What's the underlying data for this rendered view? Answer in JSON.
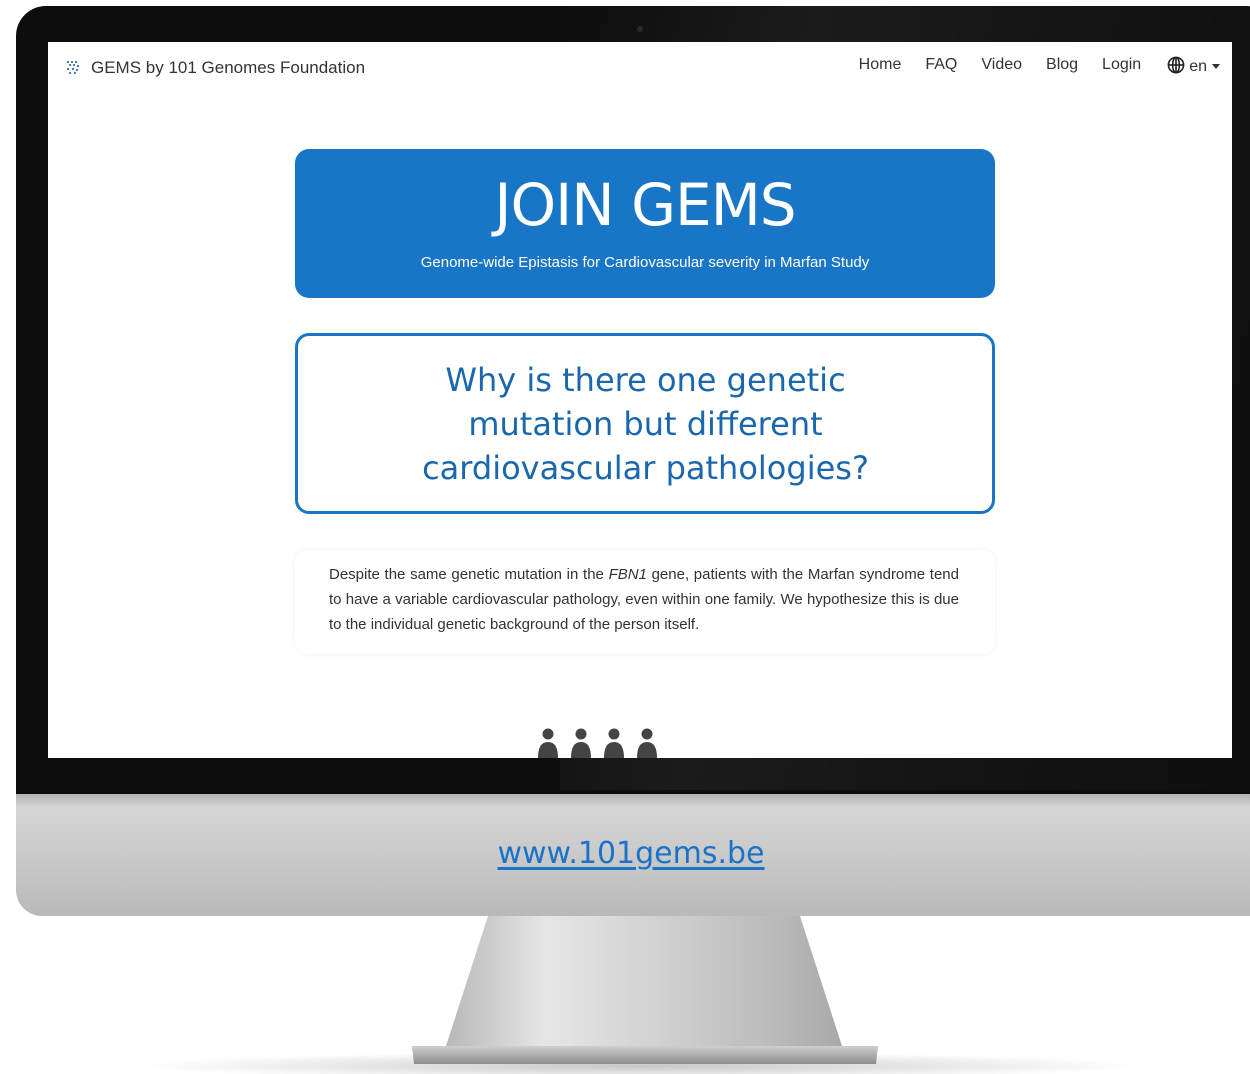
{
  "navbar": {
    "brand": "GEMS by 101 Genomes Foundation",
    "links": [
      "Home",
      "FAQ",
      "Video",
      "Blog",
      "Login"
    ],
    "language": "en",
    "icons": {
      "logo": "dna-logo-icon",
      "language": "globe-icon",
      "dropdown": "caret-down-icon"
    }
  },
  "banner": {
    "title": "JOIN GEMS",
    "subtitle": "Genome-wide Epistasis for Cardiovascular severity in Marfan Study"
  },
  "question": {
    "text": "Why is there one genetic mutation but different cardiovascular pathologies?"
  },
  "description": {
    "before": "Despite the same genetic mutation in the ",
    "gene": "FBN1",
    "after": " gene, patients with the Marfan syndrome tend to have a variable cardiovascular pathology, even within one family. We hypothesize this is due to the individual genetic background of the person itself."
  },
  "people_icon": "person-icon",
  "people_count": 4,
  "website": "www.101gems.be",
  "colors": {
    "primary": "#1976c6",
    "question_text": "#1a67ad",
    "nav_text": "#333333",
    "bezel": "#0d0d0d",
    "chin": "#c8c8c8",
    "link": "#1a73c9"
  }
}
